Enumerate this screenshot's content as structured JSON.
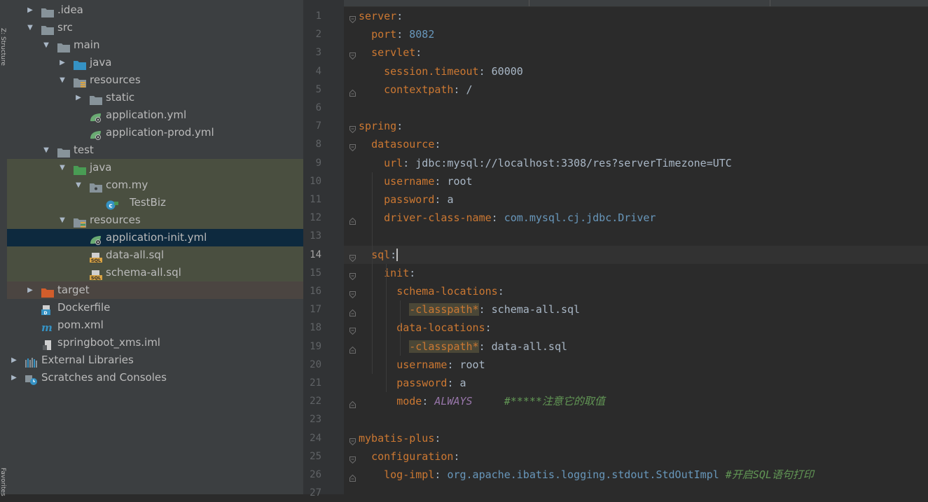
{
  "side_strip": {
    "top_label": "Z: Structure",
    "bottom_label": "Favorites"
  },
  "project_tree": [
    {
      "label": ".idea",
      "depth": 1,
      "arrow": "right",
      "icon": "folder-icon",
      "bg": ""
    },
    {
      "label": "src",
      "depth": 1,
      "arrow": "down",
      "icon": "folder-icon",
      "bg": ""
    },
    {
      "label": "main",
      "depth": 2,
      "arrow": "down",
      "icon": "folder-icon",
      "bg": ""
    },
    {
      "label": "java",
      "depth": 3,
      "arrow": "right",
      "icon": "source-folder-icon",
      "bg": ""
    },
    {
      "label": "resources",
      "depth": 3,
      "arrow": "down",
      "icon": "resources-folder-icon",
      "bg": ""
    },
    {
      "label": "static",
      "depth": 4,
      "arrow": "right",
      "icon": "folder-icon",
      "bg": ""
    },
    {
      "label": "application.yml",
      "depth": 4,
      "arrow": "",
      "icon": "spring-config-icon",
      "bg": ""
    },
    {
      "label": "application-prod.yml",
      "depth": 4,
      "arrow": "",
      "icon": "spring-config-icon",
      "bg": ""
    },
    {
      "label": "test",
      "depth": 2,
      "arrow": "down",
      "icon": "folder-icon",
      "bg": ""
    },
    {
      "label": "java",
      "depth": 3,
      "arrow": "down",
      "icon": "test-source-folder-icon",
      "bg": "test"
    },
    {
      "label": "com.my",
      "depth": 4,
      "arrow": "down",
      "icon": "package-icon",
      "bg": "test"
    },
    {
      "label": "TestBiz",
      "depth": 5,
      "arrow": "",
      "icon": "class-icon",
      "bg": "test"
    },
    {
      "label": "resources",
      "depth": 3,
      "arrow": "down",
      "icon": "test-resources-folder-icon",
      "bg": "test"
    },
    {
      "label": "application-init.yml",
      "depth": 4,
      "arrow": "",
      "icon": "spring-config-icon",
      "bg": "selected"
    },
    {
      "label": "data-all.sql",
      "depth": 4,
      "arrow": "",
      "icon": "sql-file-icon",
      "bg": "test"
    },
    {
      "label": "schema-all.sql",
      "depth": 4,
      "arrow": "",
      "icon": "sql-file-icon",
      "bg": "test"
    },
    {
      "label": "target",
      "depth": 1,
      "arrow": "right",
      "icon": "excluded-folder-icon",
      "bg": "target"
    },
    {
      "label": "Dockerfile",
      "depth": 1,
      "arrow": "",
      "icon": "docker-icon",
      "bg": ""
    },
    {
      "label": "pom.xml",
      "depth": 1,
      "arrow": "",
      "icon": "maven-icon",
      "bg": ""
    },
    {
      "label": "springboot_xms.iml",
      "depth": 1,
      "arrow": "",
      "icon": "iml-file-icon",
      "bg": ""
    },
    {
      "label": "External Libraries",
      "depth": 0,
      "arrow": "right",
      "icon": "libraries-icon",
      "bg": ""
    },
    {
      "label": "Scratches and Consoles",
      "depth": 0,
      "arrow": "right",
      "icon": "scratches-icon",
      "bg": ""
    }
  ],
  "editor": {
    "current_line": 14,
    "lines": [
      {
        "n": "1",
        "fold": "open",
        "segs": [
          {
            "t": "server",
            "c": "k"
          },
          {
            "t": ":",
            "c": "v"
          }
        ]
      },
      {
        "n": "2",
        "fold": "",
        "segs": [
          {
            "t": "  "
          },
          {
            "t": "port",
            "c": "k"
          },
          {
            "t": ": ",
            "c": "v"
          },
          {
            "t": "8082",
            "c": "n"
          }
        ]
      },
      {
        "n": "3",
        "fold": "open",
        "segs": [
          {
            "t": "  "
          },
          {
            "t": "servlet",
            "c": "k"
          },
          {
            "t": ":",
            "c": "v"
          }
        ]
      },
      {
        "n": "4",
        "fold": "",
        "segs": [
          {
            "t": "    "
          },
          {
            "t": "session.timeout",
            "c": "k"
          },
          {
            "t": ": ",
            "c": "v"
          },
          {
            "t": "60000",
            "c": "v"
          }
        ]
      },
      {
        "n": "5",
        "fold": "close",
        "segs": [
          {
            "t": "    "
          },
          {
            "t": "contextpath",
            "c": "k"
          },
          {
            "t": ": /",
            "c": "v"
          }
        ]
      },
      {
        "n": "6",
        "fold": "",
        "segs": []
      },
      {
        "n": "7",
        "fold": "open",
        "segs": [
          {
            "t": "spring",
            "c": "k"
          },
          {
            "t": ":",
            "c": "v"
          }
        ]
      },
      {
        "n": "8",
        "fold": "open",
        "segs": [
          {
            "t": "  "
          },
          {
            "t": "datasource",
            "c": "k"
          },
          {
            "t": ":",
            "c": "v"
          }
        ]
      },
      {
        "n": "9",
        "fold": "",
        "segs": [
          {
            "t": "    "
          },
          {
            "t": "url",
            "c": "k"
          },
          {
            "t": ": ",
            "c": "v"
          },
          {
            "t": "jdbc:mysql://localhost:3308/res?serverTimezone=UTC",
            "c": "v"
          }
        ]
      },
      {
        "n": "10",
        "fold": "",
        "segs": [
          {
            "t": "    "
          },
          {
            "t": "username",
            "c": "k"
          },
          {
            "t": ": ",
            "c": "v"
          },
          {
            "t": "root",
            "c": "v"
          }
        ]
      },
      {
        "n": "11",
        "fold": "",
        "segs": [
          {
            "t": "    "
          },
          {
            "t": "password",
            "c": "k"
          },
          {
            "t": ": ",
            "c": "v"
          },
          {
            "t": "a",
            "c": "v"
          }
        ]
      },
      {
        "n": "12",
        "fold": "close",
        "segs": [
          {
            "t": "    "
          },
          {
            "t": "driver-class-name",
            "c": "k"
          },
          {
            "t": ": ",
            "c": "v"
          },
          {
            "t": "com.mysql.cj.jdbc.Driver",
            "c": "n"
          }
        ]
      },
      {
        "n": "13",
        "fold": "",
        "segs": []
      },
      {
        "n": "14",
        "fold": "open",
        "segs": [
          {
            "t": "  "
          },
          {
            "t": "sql",
            "c": "k"
          },
          {
            "t": ":",
            "c": "v"
          },
          {
            "caret": true
          }
        ]
      },
      {
        "n": "15",
        "fold": "open",
        "segs": [
          {
            "t": "    "
          },
          {
            "t": "init",
            "c": "k"
          },
          {
            "t": ":",
            "c": "v"
          }
        ]
      },
      {
        "n": "16",
        "fold": "open",
        "segs": [
          {
            "t": "      "
          },
          {
            "t": "schema-locations",
            "c": "k"
          },
          {
            "t": ":",
            "c": "v"
          }
        ]
      },
      {
        "n": "17",
        "fold": "close",
        "segs": [
          {
            "t": "        "
          },
          {
            "t": "-classpath*",
            "c": "k hl"
          },
          {
            "t": ": schema-all.sql",
            "c": "v"
          }
        ]
      },
      {
        "n": "18",
        "fold": "open",
        "segs": [
          {
            "t": "      "
          },
          {
            "t": "data-locations",
            "c": "k"
          },
          {
            "t": ":",
            "c": "v"
          }
        ]
      },
      {
        "n": "19",
        "fold": "close",
        "segs": [
          {
            "t": "        "
          },
          {
            "t": "-classpath*",
            "c": "k hl"
          },
          {
            "t": ": data-all.sql",
            "c": "v"
          }
        ]
      },
      {
        "n": "20",
        "fold": "",
        "segs": [
          {
            "t": "      "
          },
          {
            "t": "username",
            "c": "k"
          },
          {
            "t": ": ",
            "c": "v"
          },
          {
            "t": "root",
            "c": "v"
          }
        ]
      },
      {
        "n": "21",
        "fold": "",
        "segs": [
          {
            "t": "      "
          },
          {
            "t": "password",
            "c": "k"
          },
          {
            "t": ": ",
            "c": "v"
          },
          {
            "t": "a",
            "c": "v"
          }
        ]
      },
      {
        "n": "22",
        "fold": "close",
        "segs": [
          {
            "t": "      "
          },
          {
            "t": "mode",
            "c": "k"
          },
          {
            "t": ": ",
            "c": "v"
          },
          {
            "t": "ALWAYS",
            "c": "e"
          },
          {
            "t": "     "
          },
          {
            "t": "#*****注意它的取值",
            "c": "c"
          }
        ]
      },
      {
        "n": "23",
        "fold": "",
        "segs": []
      },
      {
        "n": "24",
        "fold": "open",
        "segs": [
          {
            "t": "mybatis-plus",
            "c": "k"
          },
          {
            "t": ":",
            "c": "v"
          }
        ]
      },
      {
        "n": "25",
        "fold": "open",
        "segs": [
          {
            "t": "  "
          },
          {
            "t": "configuration",
            "c": "k"
          },
          {
            "t": ":",
            "c": "v"
          }
        ]
      },
      {
        "n": "26",
        "fold": "close",
        "segs": [
          {
            "t": "    "
          },
          {
            "t": "log-impl",
            "c": "k"
          },
          {
            "t": ": ",
            "c": "v"
          },
          {
            "t": "org.apache.ibatis.logging.stdout.StdOutImpl",
            "c": "n"
          },
          {
            "t": " "
          },
          {
            "t": "#开启SQL语句打印",
            "c": "c"
          }
        ]
      },
      {
        "n": "27",
        "fold": "",
        "segs": []
      }
    ]
  }
}
